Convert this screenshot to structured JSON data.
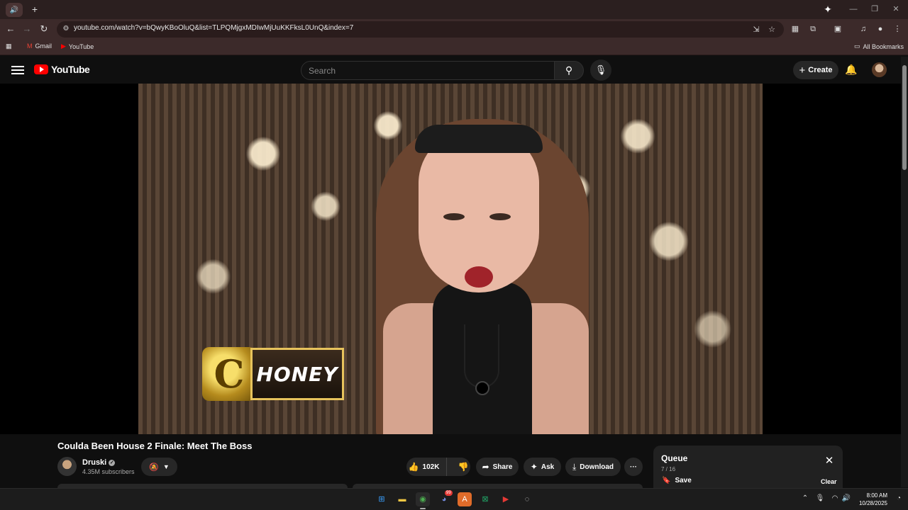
{
  "browser": {
    "tab_icon": "speaker-icon",
    "new_tab_glyph": "+",
    "url": "youtube.com/watch?v=bQwyKBoOluQ&list=TLPQMjgxMDIwMjUuKKFksL0UnQ&index=7",
    "bookmarks": [
      {
        "label": "Gmail",
        "icon": "gmail-icon"
      },
      {
        "label": "YouTube",
        "icon": "youtube-icon"
      }
    ],
    "all_bookmarks": "All Bookmarks"
  },
  "youtube": {
    "logo_text": "YouTube",
    "search_placeholder": "Search",
    "create_label": "Create"
  },
  "video": {
    "title": "Coulda Been House 2 Finale: Meet The Boss",
    "lower_third_logo": "C",
    "lower_third_name": "HONEY",
    "channel": {
      "name": "Druski",
      "subscribers": "4.35M subscribers"
    },
    "actions": {
      "likes": "102K",
      "share": "Share",
      "ask": "Ask",
      "download": "Download",
      "more": "···"
    }
  },
  "queue": {
    "title": "Queue",
    "position": "7 / 16",
    "save": "Save",
    "clear": "Clear"
  },
  "taskbar": {
    "badge_count": "99",
    "time": "8:00 AM",
    "date": "10/28/2025"
  },
  "colors": {
    "youtube_red": "#ff0000",
    "page_bg": "#0f0f0f",
    "chrome_frame": "#3c2a2a",
    "lower_third_gold": "#e7c35c"
  }
}
